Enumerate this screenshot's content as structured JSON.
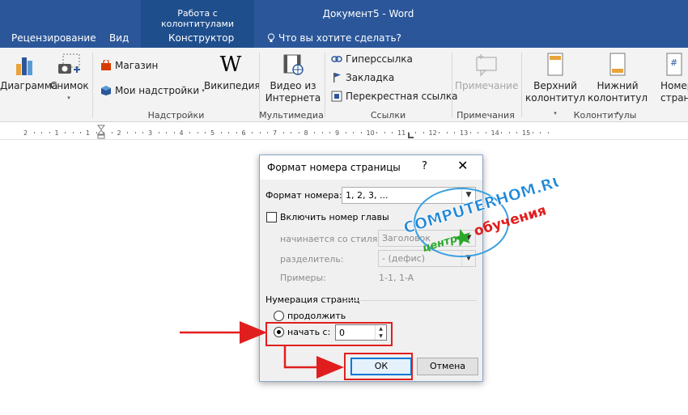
{
  "titlebar": {
    "context_group": "Работа с колонтитулами",
    "document_title": "Документ5 - Word"
  },
  "tabs": {
    "review": "Рецензирование",
    "view": "Вид",
    "constructor": "Конструктор",
    "tell_me": "Что вы хотите сделать?"
  },
  "ribbon": {
    "chart": "Диаграмма",
    "snapshot": "Снимок",
    "store": "Магазин",
    "my_addins": "Мои надстройки",
    "wikipedia": "Википедия",
    "addins_group": "Надстройки",
    "online_video_line1": "Видео из",
    "online_video_line2": "Интернета",
    "media_group": "Мультимедиа",
    "hyperlink": "Гиперссылка",
    "bookmark": "Закладка",
    "cross_reference": "Перекрестная ссылка",
    "links_group": "Ссылки",
    "comment": "Примечание",
    "comments_group": "Примечания",
    "header_line1": "Верхний",
    "header_line2": "колонтитул",
    "footer_line1": "Нижний",
    "footer_line2": "колонтитул",
    "page_number_line1": "Номер",
    "page_number_line2": "страниц",
    "header_footer_group": "Колонтитулы"
  },
  "ruler": {
    "numbers": [
      "2",
      "1",
      "1",
      "2",
      "3",
      "4",
      "5",
      "6",
      "7",
      "8",
      "9",
      "10",
      "11",
      "12",
      "13",
      "14",
      "15"
    ]
  },
  "dialog": {
    "title": "Формат номера страницы",
    "help": "?",
    "close": "✕",
    "number_format_label": "Формат номера:",
    "number_format_value": "1, 2, 3, ...",
    "include_chapter_label": "Включить номер главы",
    "chapter_starts_label": "начинается со стиля:",
    "chapter_starts_value": "Заголовок",
    "separator_label": "разделитель:",
    "separator_value": "-    (дефис)",
    "examples_label": "Примеры:",
    "examples_value": "1-1, 1-A",
    "page_numbering_label": "Нумерация страниц",
    "continue_label": "продолжить",
    "start_at_label": "начать с:",
    "start_at_value": "0",
    "ok_label": "ОК",
    "cancel_label": "Отмена"
  },
  "watermark": {
    "line1": "COMPUTERHOM.RU",
    "line2": "центр",
    "line3": "обучения"
  },
  "colors": {
    "word_blue": "#2b579a",
    "context_band": "#1f4e8c",
    "annotation_red": "#e11e1e",
    "default_button_border": "#0078d7"
  }
}
